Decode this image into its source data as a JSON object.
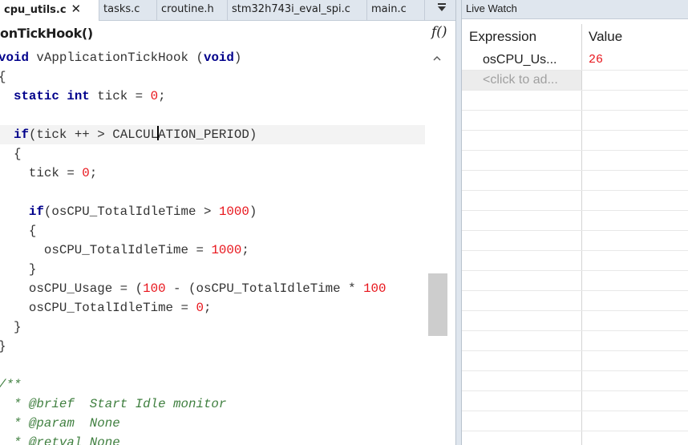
{
  "editor": {
    "tabs": [
      {
        "label": "cpu_utils.c",
        "close": "✕",
        "active": true
      },
      {
        "label": "tasks.c",
        "active": false
      },
      {
        "label": "croutine.h",
        "active": false
      },
      {
        "label": "stm32h743i_eval_spi.c",
        "active": false
      },
      {
        "label": "main.c",
        "active": false
      }
    ],
    "tab_menu_icon": "tab-list-icon",
    "function_name": "onTickHook()",
    "function_icon": "f()",
    "code_lines": [
      "void vApplicationTickHook (void)",
      "{",
      "  static int tick = 0;",
      "",
      "  if(tick ++ > CALCULATION_PERIOD)",
      "  {",
      "    tick = 0;",
      "",
      "    if(osCPU_TotalIdleTime > 1000)",
      "    {",
      "      osCPU_TotalIdleTime = 1000;",
      "    }",
      "    osCPU_Usage = (100 - (osCPU_TotalIdleTime * 100",
      "    osCPU_TotalIdleTime = 0;",
      "  }",
      "}",
      "",
      "/**",
      "  * @brief  Start Idle monitor",
      "  * @param  None",
      "  * @retval None"
    ],
    "scroll_up": "^"
  },
  "live_watch": {
    "title": "Live Watch",
    "columns": [
      "Expression",
      "Value"
    ],
    "rows": [
      {
        "expression": "osCPU_Us...",
        "value": "26"
      }
    ],
    "add_placeholder": "<click to ad..."
  }
}
